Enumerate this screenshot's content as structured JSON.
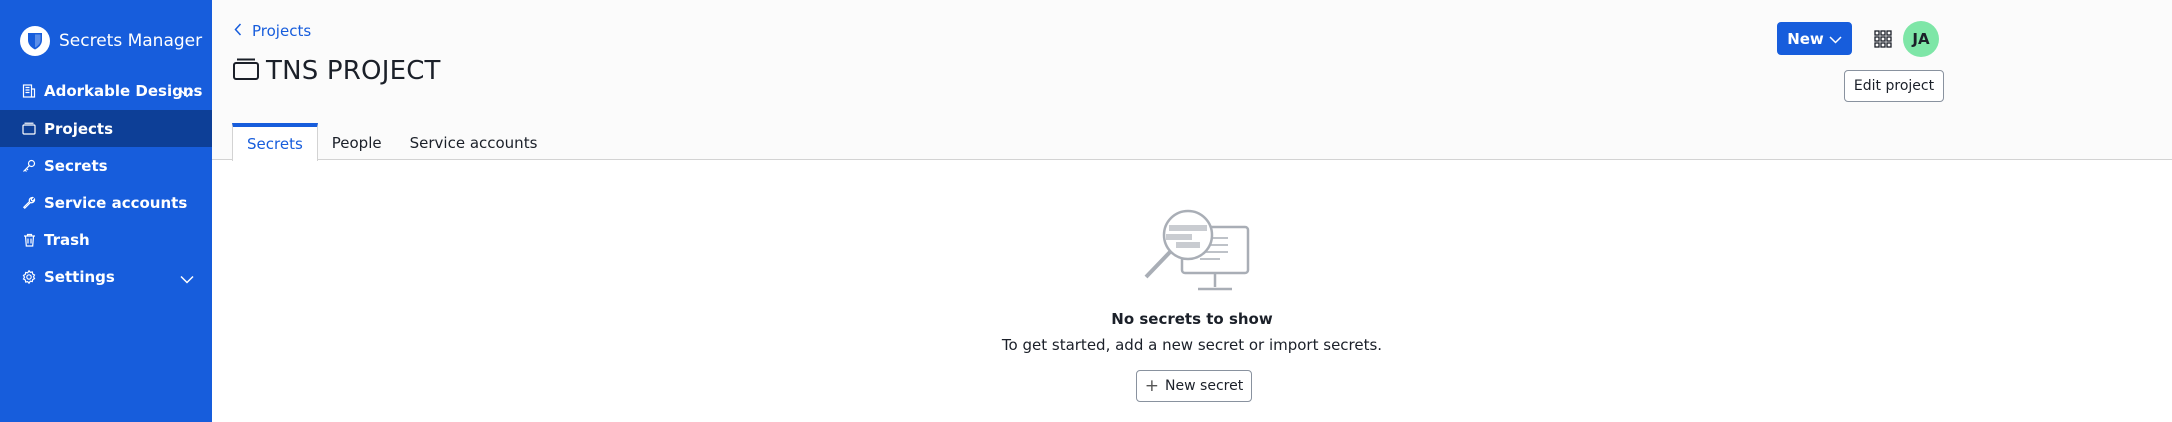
{
  "sidebar": {
    "brand": "Secrets Manager",
    "items": [
      {
        "label": "Adorkable Designs",
        "icon": "organization-icon",
        "expandable": true
      },
      {
        "label": "Projects",
        "icon": "project-folder-icon",
        "active": true
      },
      {
        "label": "Secrets",
        "icon": "key-icon"
      },
      {
        "label": "Service accounts",
        "icon": "wrench-icon"
      },
      {
        "label": "Trash",
        "icon": "trash-icon"
      },
      {
        "label": "Settings",
        "icon": "gear-icon",
        "expandable": true
      }
    ]
  },
  "header": {
    "breadcrumb": "Projects",
    "title": "TNS PROJECT",
    "new_label": "New",
    "avatar_initials": "JA",
    "edit_label": "Edit project",
    "tabs": [
      {
        "label": "Secrets",
        "active": true
      },
      {
        "label": "People"
      },
      {
        "label": "Service accounts"
      }
    ]
  },
  "empty_state": {
    "heading": "No secrets to show",
    "description": "To get started, add a new secret or import secrets.",
    "button_label": "New secret"
  },
  "colors": {
    "brand": "#175ddc",
    "sidebar_active": "#0d3f97",
    "avatar": "#7ee6a7"
  }
}
